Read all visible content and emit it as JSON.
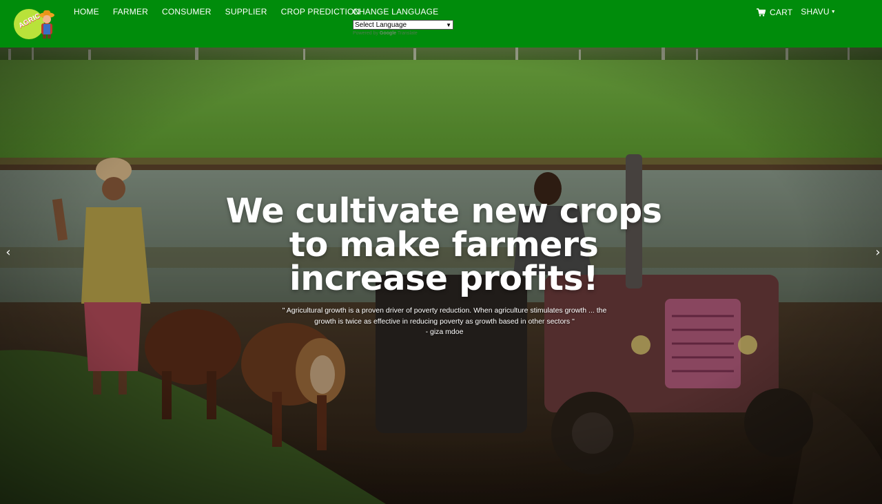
{
  "logo": {
    "text": "AGRIC"
  },
  "nav": {
    "items": [
      {
        "label": "HOME"
      },
      {
        "label": "FARMER"
      },
      {
        "label": "CONSUMER"
      },
      {
        "label": "SUPPLIER"
      },
      {
        "label": "CROP PREDICTION"
      }
    ],
    "change_language": "CHANGE LANGUAGE",
    "language_select": {
      "selected": "Select Language"
    },
    "powered_by": {
      "prefix": "Powered by ",
      "google": "Google",
      "suffix": " Translate"
    },
    "cart_label": "CART",
    "user_label": "SHAVU"
  },
  "hero": {
    "title_lines": [
      "We cultivate new crops",
      "to make farmers",
      "increase profits!"
    ],
    "quote_lines": [
      "\" Agricultural growth is a proven driver of poverty reduction. When agriculture stimulates growth ... the",
      "growth is twice as effective in reducing poverty as growth based in other sectors \""
    ],
    "quote_author": "- giza mdoe"
  },
  "carousel": {
    "prev_icon": "chevron-left-icon",
    "next_icon": "chevron-right-icon"
  },
  "colors": {
    "navbar": "#008c0b",
    "text": "#ffffff"
  }
}
